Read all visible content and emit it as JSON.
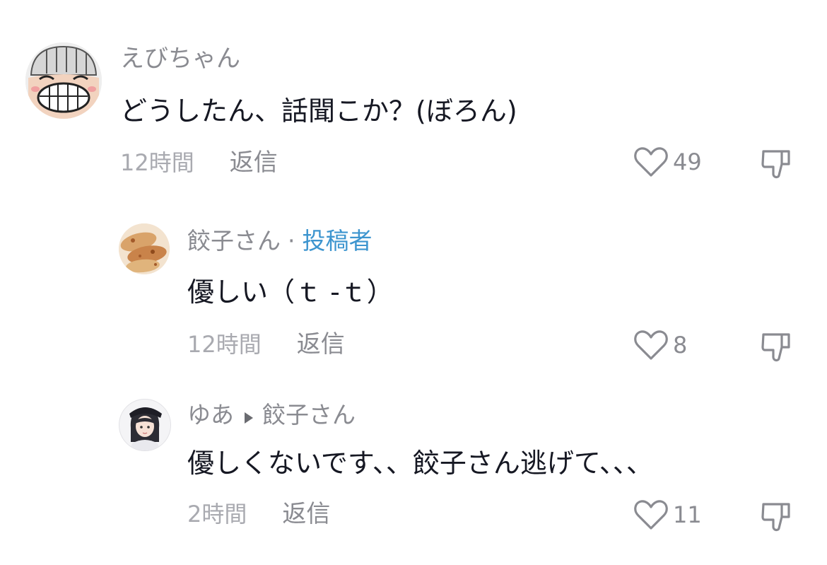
{
  "comments": [
    {
      "username": "えびちゃん",
      "text": "どうしたん、話聞こか？(ぼろん)",
      "time": "12時間",
      "reply_label": "返信",
      "likes": "49",
      "avatar_icon": "grinning-cartoon-avatar"
    },
    {
      "username": "餃子さん",
      "separator": "·",
      "author_badge": "投稿者",
      "text": "優しい（ｔ -ｔ）",
      "time": "12時間",
      "reply_label": "返信",
      "likes": "8",
      "avatar_icon": "gyoza-photo-avatar"
    },
    {
      "username": "ゆあ",
      "reply_to": "餃子さん",
      "text": "優しくないです、、餃子さん逃げて、、、",
      "time": "2時間",
      "reply_label": "返信",
      "likes": "11",
      "avatar_icon": "anime-girl-avatar"
    }
  ],
  "colors": {
    "primary_text": "#161823",
    "secondary_text": "#8a8b91",
    "author_badge": "#3d95cf"
  }
}
